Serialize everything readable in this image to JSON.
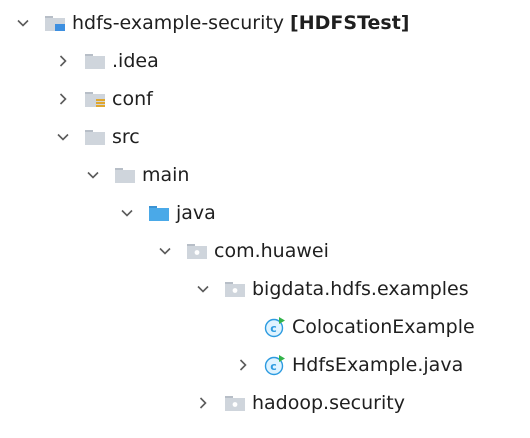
{
  "tree": {
    "nodes": [
      {
        "name": "hdfs-example-security",
        "tag": "[HDFSTest]",
        "type": "module",
        "state": "expanded"
      },
      {
        "name": ".idea",
        "type": "folder",
        "state": "collapsed"
      },
      {
        "name": "conf",
        "type": "resources-folder",
        "state": "collapsed"
      },
      {
        "name": "src",
        "type": "folder",
        "state": "expanded"
      },
      {
        "name": "main",
        "type": "folder",
        "state": "expanded"
      },
      {
        "name": "java",
        "type": "source-folder",
        "state": "expanded"
      },
      {
        "name": "com.huawei",
        "type": "package",
        "state": "expanded"
      },
      {
        "name": "bigdata.hdfs.examples",
        "type": "package",
        "state": "expanded"
      },
      {
        "name": "ColocationExample",
        "type": "class-runnable",
        "state": "leaf"
      },
      {
        "name": "HdfsExample.java",
        "type": "class-runnable",
        "state": "collapsed"
      },
      {
        "name": "hadoop.security",
        "type": "package",
        "state": "collapsed"
      }
    ]
  },
  "icons": {
    "expanded": "chevron-down-icon",
    "collapsed": "chevron-right-icon",
    "module": "module-folder-icon",
    "folder": "folder-icon",
    "resources-folder": "resources-folder-icon",
    "source-folder": "source-folder-icon",
    "package": "package-icon",
    "class-runnable": "runnable-class-icon"
  },
  "colors": {
    "folder": "#cfd5dc",
    "source_folder": "#4aa9e8",
    "module_accent": "#3d8fe0",
    "class_ring": "#2c9be0",
    "run_badge": "#33b34a",
    "resources_bars": "#e0a72f",
    "text": "#1f1f1f",
    "chevron": "#5b5b5b"
  }
}
